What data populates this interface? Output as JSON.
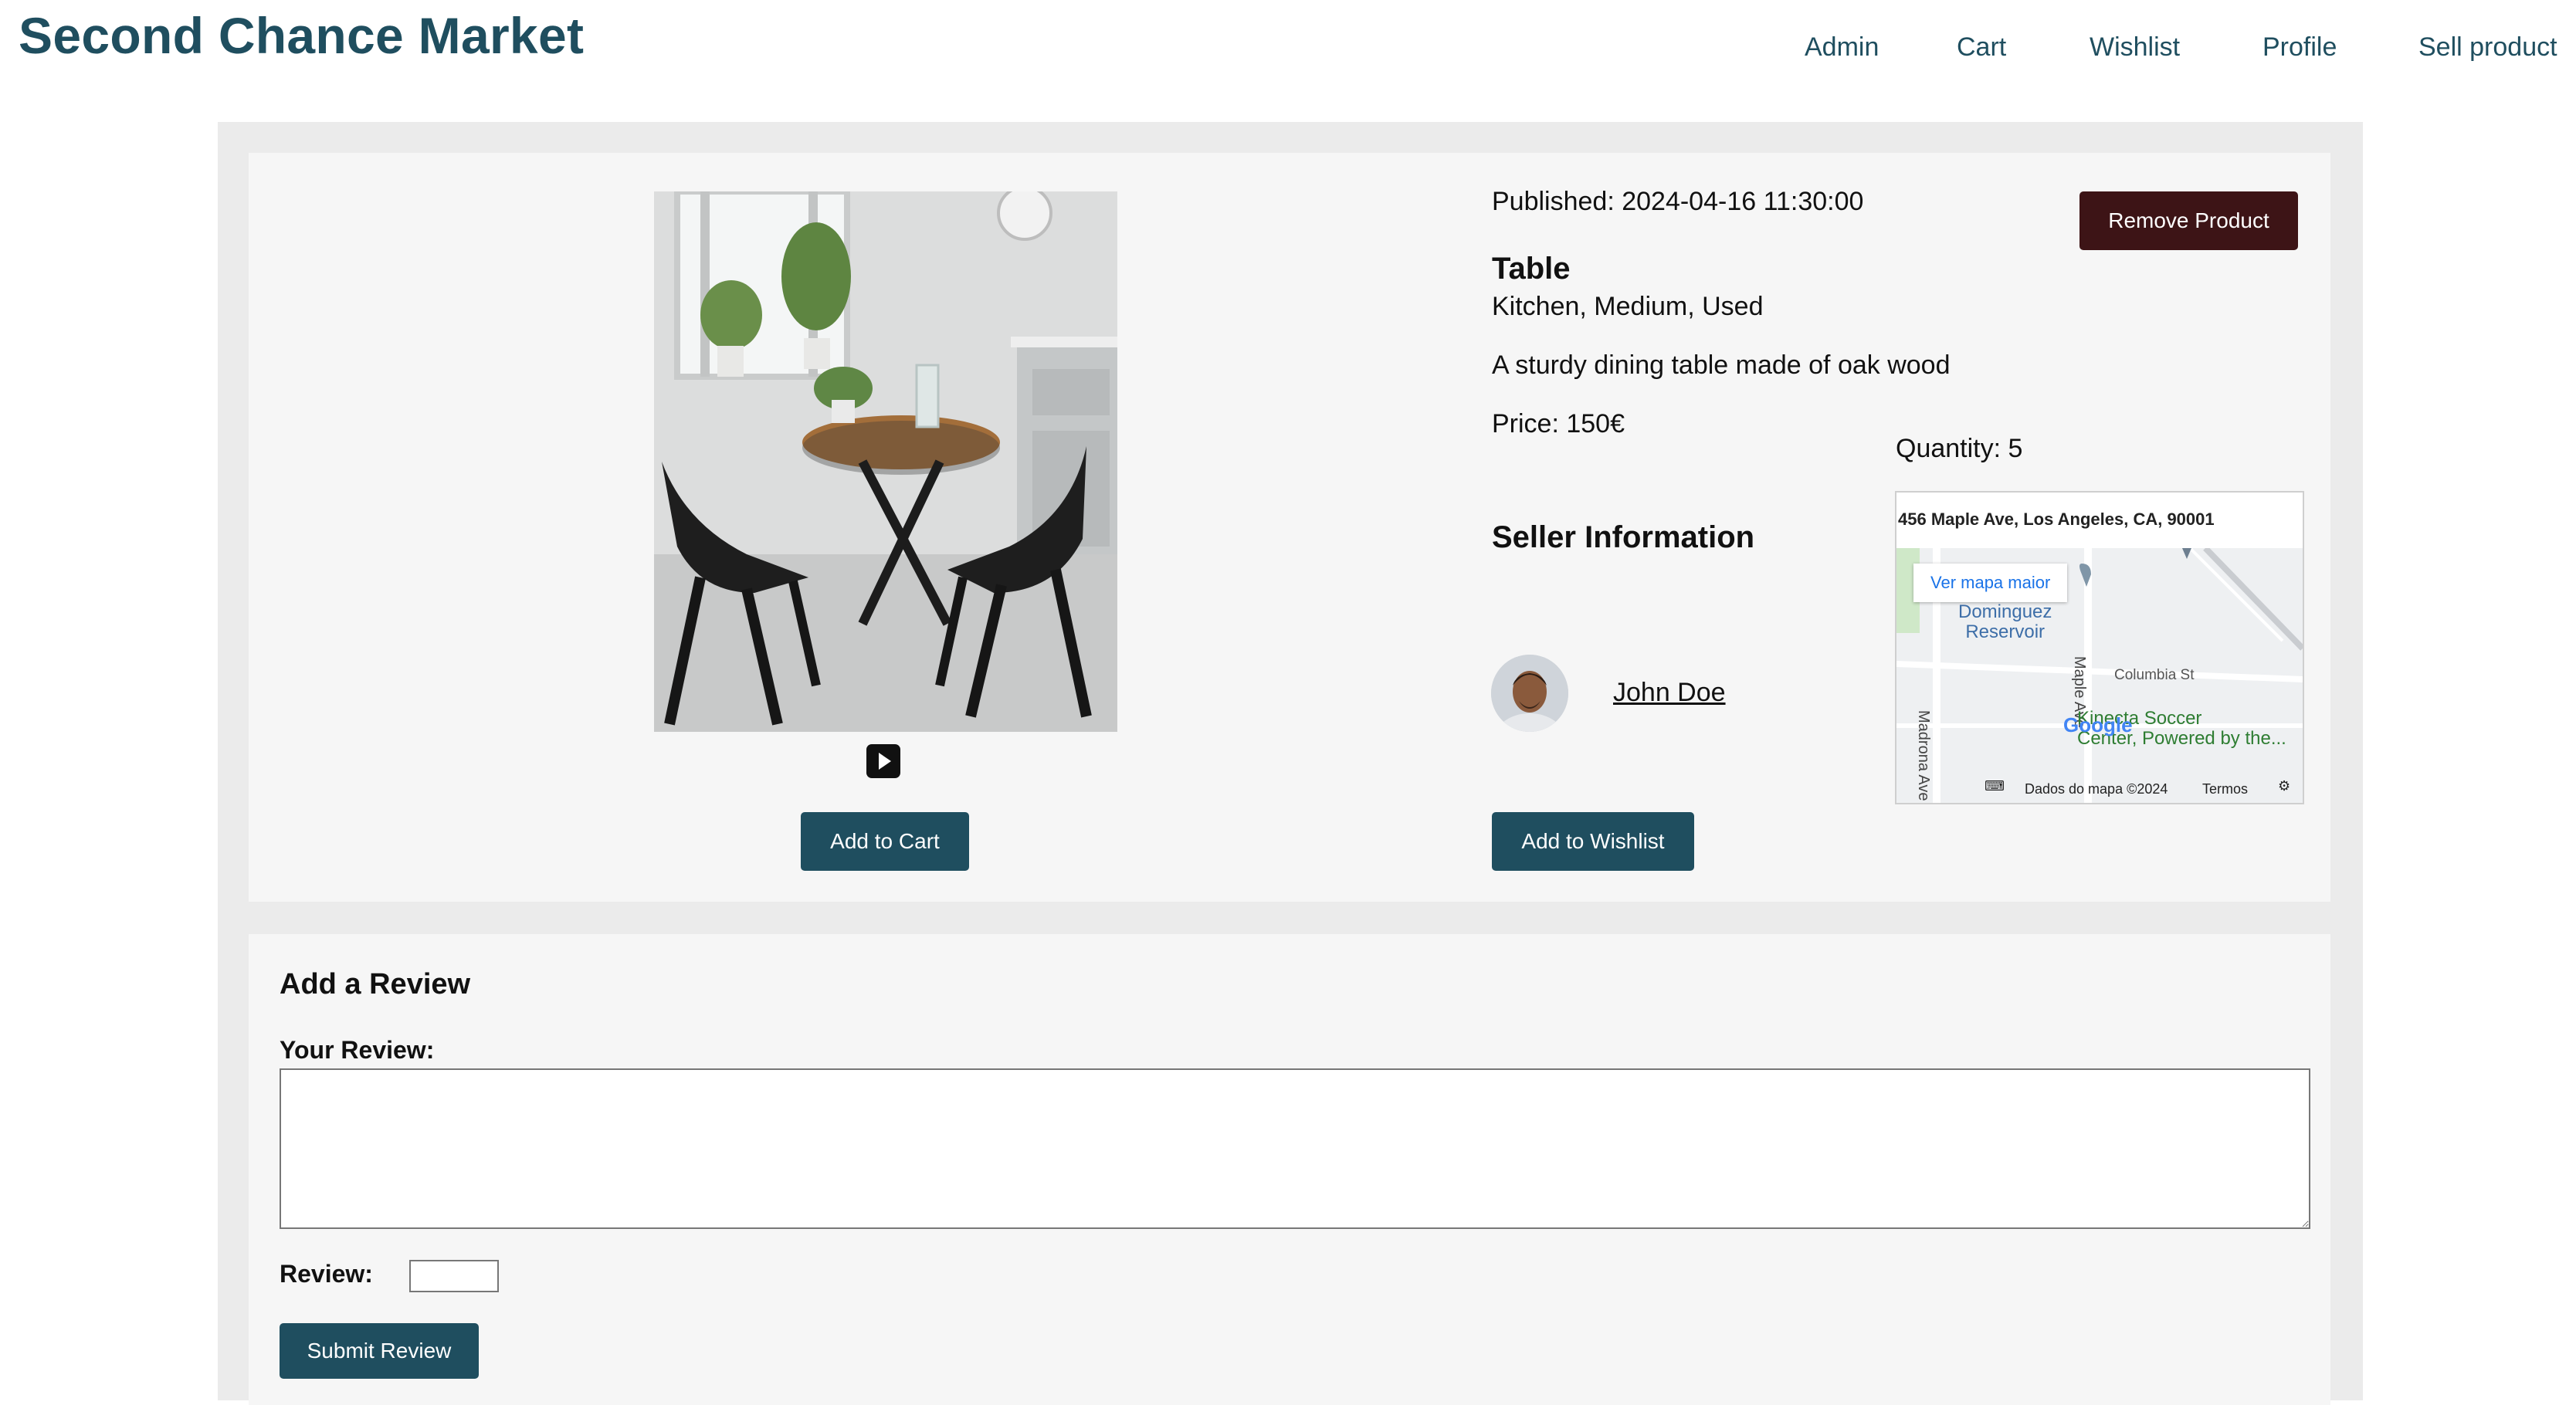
{
  "header": {
    "brand": "Second Chance Market",
    "nav": [
      "Admin",
      "Cart",
      "Wishlist",
      "Profile",
      "Sell product"
    ]
  },
  "product": {
    "published": "Published: 2024-04-16 11:30:00",
    "name": "Table",
    "tags": "Kitchen, Medium, Used",
    "description": "A sturdy dining table made of oak wood",
    "price": "Price: 150€",
    "quantity": "Quantity: 5",
    "remove_label": "Remove Product",
    "add_to_cart_label": "Add to Cart",
    "add_to_wishlist_label": "Add to Wishlist"
  },
  "seller": {
    "heading": "Seller Information",
    "name": "John Doe"
  },
  "map": {
    "address": "456 Maple Ave, Los Angeles, CA, 90001",
    "view_larger": "Ver mapa maior",
    "labels": {
      "reservoir_line1": "Dominguez",
      "reservoir_line2": "Reservoir",
      "maple_ave": "Maple Ave",
      "madrona_ave": "Madrona Ave",
      "columbia_st": "Columbia St",
      "soccer_line1": "Kinecta Soccer",
      "soccer_line2": "Center, Powered by the...",
      "google": "Google"
    },
    "footer_data": "Dados do mapa ©2024",
    "footer_terms": "Termos"
  },
  "review": {
    "title": "Add a Review",
    "your_review_label": "Your Review:",
    "rating_label": "Review:",
    "submit_label": "Submit Review"
  },
  "colors": {
    "brand": "#1f4e5f",
    "primary_button": "#1f4e5f",
    "danger_button": "#3d1416"
  }
}
